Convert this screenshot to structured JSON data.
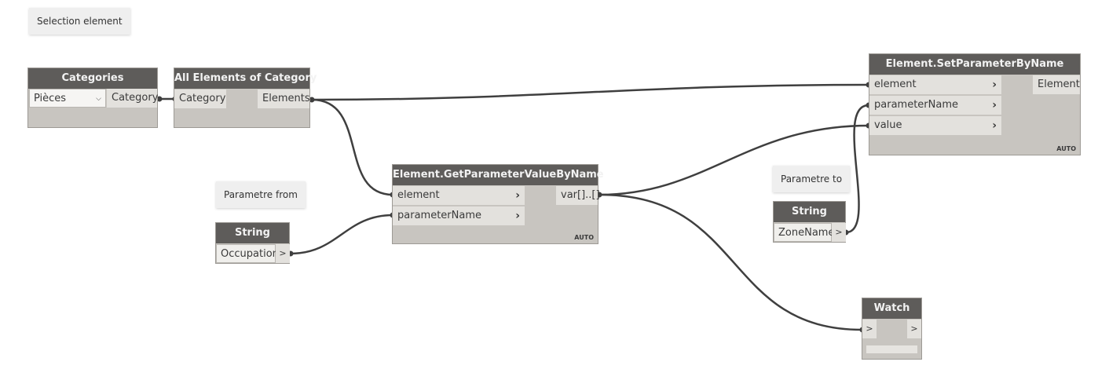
{
  "notes": {
    "selection": "Selection element",
    "param_from": "Parametre from",
    "param_to": "Parametre to"
  },
  "nodes": {
    "categories": {
      "title": "Categories",
      "dropdown_value": "Pièces",
      "output": "Category"
    },
    "all_elements": {
      "title": "All Elements of Category",
      "input": "Category",
      "output": "Elements"
    },
    "get_param": {
      "title": "Element.GetParameterValueByName",
      "inputs": [
        "element",
        "parameterName"
      ],
      "output": "var[]..[]",
      "lacing": "AUTO"
    },
    "set_param": {
      "title": "Element.SetParameterByName",
      "inputs": [
        "element",
        "parameterName",
        "value"
      ],
      "output": "Element",
      "lacing": "AUTO"
    },
    "string_from": {
      "title": "String",
      "value": "Occupation",
      "port": ">"
    },
    "string_to": {
      "title": "String",
      "value": "ZoneName",
      "port": ">"
    },
    "watch": {
      "title": "Watch",
      "input": ">",
      "output": ">"
    }
  },
  "icons": {
    "chevron": "chevron-right-icon",
    "dropdown": "chevron-down-icon"
  },
  "colors": {
    "header": "#5e5c5a",
    "body": "#c8c5c0",
    "port": "#e3e1dd",
    "wire": "#3f3f3f"
  }
}
